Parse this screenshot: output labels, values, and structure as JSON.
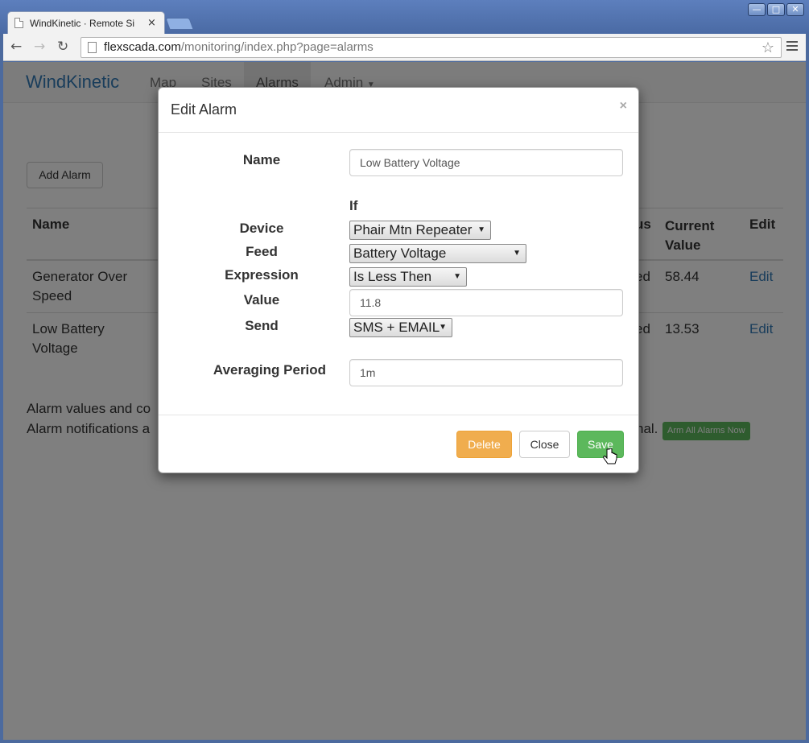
{
  "browser": {
    "tab_title": "WindKinetic · Remote Si",
    "tab_close": "×",
    "url_host": "flexscada.com",
    "url_path": "/monitoring/index.php?page=alarms",
    "window_buttons": [
      "—",
      "□",
      "✕"
    ]
  },
  "navbar": {
    "brand": "WindKinetic",
    "links": [
      "Map",
      "Sites",
      "Alarms",
      "Admin"
    ],
    "active": "Alarms"
  },
  "page": {
    "add_alarm_label": "Add Alarm",
    "table_headers": {
      "name": "Name",
      "status_partial": "us",
      "current_value": "Current Value",
      "current_value_line1": "Current",
      "current_value_line2": "Value",
      "edit": "Edit"
    },
    "rows": [
      {
        "name_line1": "Generator Over",
        "name_line2": "Speed",
        "status_partial": "ed",
        "current_value": "58.44",
        "edit": "Edit"
      },
      {
        "name_line1": "Low Battery",
        "name_line2": "Voltage",
        "status_partial": "ed",
        "current_value": "13.53",
        "edit": "Edit"
      }
    ],
    "note_line1_partial": "Alarm values and co",
    "note_line2_partial": "Alarm notifications a",
    "note_line2_tail": "nal.",
    "arm_button": "Arm All Alarms Now"
  },
  "modal": {
    "title": "Edit Alarm",
    "close_x": "×",
    "labels": {
      "name": "Name",
      "if": "If",
      "device": "Device",
      "feed": "Feed",
      "expression": "Expression",
      "value": "Value",
      "send": "Send",
      "averaging_period": "Averaging Period"
    },
    "fields": {
      "name_value": "Low Battery Voltage",
      "device_selected": "Phair Mtn Repeater",
      "feed_selected": "Battery Voltage",
      "expression_selected": "Is Less Then",
      "value_value": "11.8",
      "send_selected": "SMS + EMAIL",
      "averaging_period_value": "1m"
    },
    "buttons": {
      "delete": "Delete",
      "close": "Close",
      "save": "Save"
    }
  },
  "colors": {
    "brand": "#337ab7",
    "danger_warning": "#f0ad4e",
    "success": "#5cb85c"
  }
}
